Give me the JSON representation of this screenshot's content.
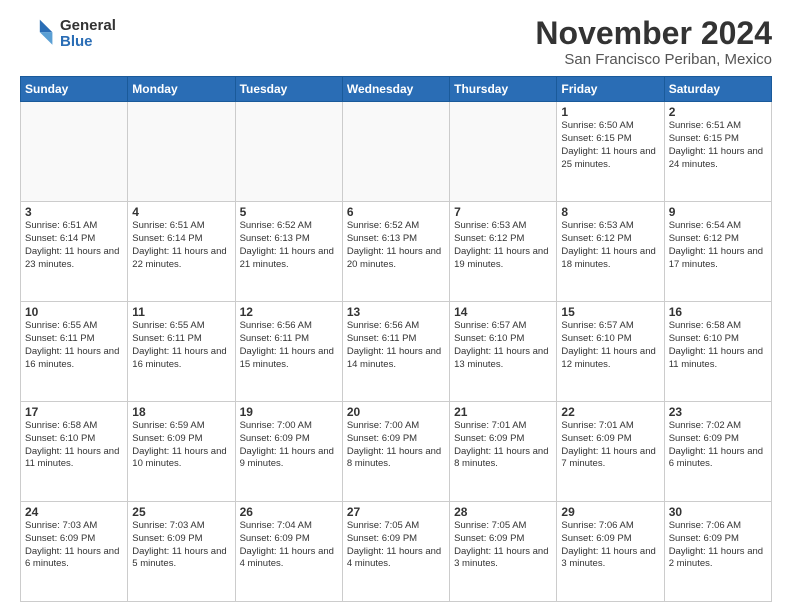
{
  "logo": {
    "general": "General",
    "blue": "Blue"
  },
  "title": "November 2024",
  "subtitle": "San Francisco Periban, Mexico",
  "headers": [
    "Sunday",
    "Monday",
    "Tuesday",
    "Wednesday",
    "Thursday",
    "Friday",
    "Saturday"
  ],
  "weeks": [
    [
      {
        "day": "",
        "detail": "",
        "empty": true
      },
      {
        "day": "",
        "detail": "",
        "empty": true
      },
      {
        "day": "",
        "detail": "",
        "empty": true
      },
      {
        "day": "",
        "detail": "",
        "empty": true
      },
      {
        "day": "",
        "detail": "",
        "empty": true
      },
      {
        "day": "1",
        "detail": "Sunrise: 6:50 AM\nSunset: 6:15 PM\nDaylight: 11 hours\nand 25 minutes.",
        "empty": false
      },
      {
        "day": "2",
        "detail": "Sunrise: 6:51 AM\nSunset: 6:15 PM\nDaylight: 11 hours\nand 24 minutes.",
        "empty": false
      }
    ],
    [
      {
        "day": "3",
        "detail": "Sunrise: 6:51 AM\nSunset: 6:14 PM\nDaylight: 11 hours\nand 23 minutes.",
        "empty": false
      },
      {
        "day": "4",
        "detail": "Sunrise: 6:51 AM\nSunset: 6:14 PM\nDaylight: 11 hours\nand 22 minutes.",
        "empty": false
      },
      {
        "day": "5",
        "detail": "Sunrise: 6:52 AM\nSunset: 6:13 PM\nDaylight: 11 hours\nand 21 minutes.",
        "empty": false
      },
      {
        "day": "6",
        "detail": "Sunrise: 6:52 AM\nSunset: 6:13 PM\nDaylight: 11 hours\nand 20 minutes.",
        "empty": false
      },
      {
        "day": "7",
        "detail": "Sunrise: 6:53 AM\nSunset: 6:12 PM\nDaylight: 11 hours\nand 19 minutes.",
        "empty": false
      },
      {
        "day": "8",
        "detail": "Sunrise: 6:53 AM\nSunset: 6:12 PM\nDaylight: 11 hours\nand 18 minutes.",
        "empty": false
      },
      {
        "day": "9",
        "detail": "Sunrise: 6:54 AM\nSunset: 6:12 PM\nDaylight: 11 hours\nand 17 minutes.",
        "empty": false
      }
    ],
    [
      {
        "day": "10",
        "detail": "Sunrise: 6:55 AM\nSunset: 6:11 PM\nDaylight: 11 hours\nand 16 minutes.",
        "empty": false
      },
      {
        "day": "11",
        "detail": "Sunrise: 6:55 AM\nSunset: 6:11 PM\nDaylight: 11 hours\nand 16 minutes.",
        "empty": false
      },
      {
        "day": "12",
        "detail": "Sunrise: 6:56 AM\nSunset: 6:11 PM\nDaylight: 11 hours\nand 15 minutes.",
        "empty": false
      },
      {
        "day": "13",
        "detail": "Sunrise: 6:56 AM\nSunset: 6:11 PM\nDaylight: 11 hours\nand 14 minutes.",
        "empty": false
      },
      {
        "day": "14",
        "detail": "Sunrise: 6:57 AM\nSunset: 6:10 PM\nDaylight: 11 hours\nand 13 minutes.",
        "empty": false
      },
      {
        "day": "15",
        "detail": "Sunrise: 6:57 AM\nSunset: 6:10 PM\nDaylight: 11 hours\nand 12 minutes.",
        "empty": false
      },
      {
        "day": "16",
        "detail": "Sunrise: 6:58 AM\nSunset: 6:10 PM\nDaylight: 11 hours\nand 11 minutes.",
        "empty": false
      }
    ],
    [
      {
        "day": "17",
        "detail": "Sunrise: 6:58 AM\nSunset: 6:10 PM\nDaylight: 11 hours\nand 11 minutes.",
        "empty": false
      },
      {
        "day": "18",
        "detail": "Sunrise: 6:59 AM\nSunset: 6:09 PM\nDaylight: 11 hours\nand 10 minutes.",
        "empty": false
      },
      {
        "day": "19",
        "detail": "Sunrise: 7:00 AM\nSunset: 6:09 PM\nDaylight: 11 hours\nand 9 minutes.",
        "empty": false
      },
      {
        "day": "20",
        "detail": "Sunrise: 7:00 AM\nSunset: 6:09 PM\nDaylight: 11 hours\nand 8 minutes.",
        "empty": false
      },
      {
        "day": "21",
        "detail": "Sunrise: 7:01 AM\nSunset: 6:09 PM\nDaylight: 11 hours\nand 8 minutes.",
        "empty": false
      },
      {
        "day": "22",
        "detail": "Sunrise: 7:01 AM\nSunset: 6:09 PM\nDaylight: 11 hours\nand 7 minutes.",
        "empty": false
      },
      {
        "day": "23",
        "detail": "Sunrise: 7:02 AM\nSunset: 6:09 PM\nDaylight: 11 hours\nand 6 minutes.",
        "empty": false
      }
    ],
    [
      {
        "day": "24",
        "detail": "Sunrise: 7:03 AM\nSunset: 6:09 PM\nDaylight: 11 hours\nand 6 minutes.",
        "empty": false
      },
      {
        "day": "25",
        "detail": "Sunrise: 7:03 AM\nSunset: 6:09 PM\nDaylight: 11 hours\nand 5 minutes.",
        "empty": false
      },
      {
        "day": "26",
        "detail": "Sunrise: 7:04 AM\nSunset: 6:09 PM\nDaylight: 11 hours\nand 4 minutes.",
        "empty": false
      },
      {
        "day": "27",
        "detail": "Sunrise: 7:05 AM\nSunset: 6:09 PM\nDaylight: 11 hours\nand 4 minutes.",
        "empty": false
      },
      {
        "day": "28",
        "detail": "Sunrise: 7:05 AM\nSunset: 6:09 PM\nDaylight: 11 hours\nand 3 minutes.",
        "empty": false
      },
      {
        "day": "29",
        "detail": "Sunrise: 7:06 AM\nSunset: 6:09 PM\nDaylight: 11 hours\nand 3 minutes.",
        "empty": false
      },
      {
        "day": "30",
        "detail": "Sunrise: 7:06 AM\nSunset: 6:09 PM\nDaylight: 11 hours\nand 2 minutes.",
        "empty": false
      }
    ]
  ]
}
